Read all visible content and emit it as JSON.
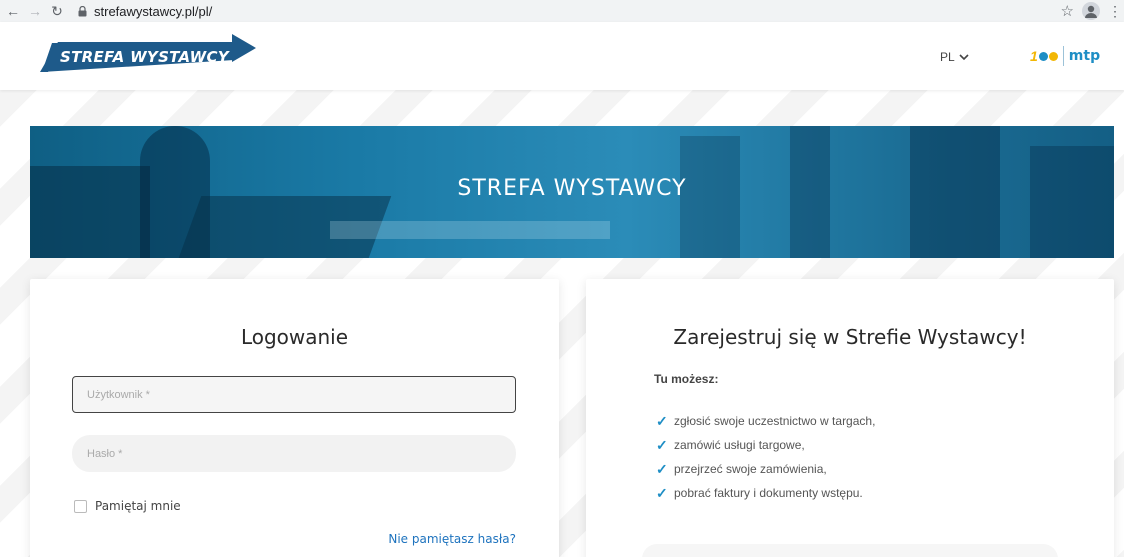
{
  "browser": {
    "url": "strefawystawcy.pl/pl/"
  },
  "header": {
    "logo_text": "STREFA WYSTAWCY",
    "language": "PL",
    "mtp_text": "mtp",
    "mtp_number": "1"
  },
  "banner": {
    "title": "STREFA WYSTAWCY"
  },
  "login": {
    "title": "Logowanie",
    "username_placeholder": "Użytkownik *",
    "password_placeholder": "Hasło *",
    "remember_label": "Pamiętaj mnie",
    "forgot_link": "Nie pamiętasz hasła?"
  },
  "register": {
    "title": "Zarejestruj się w Strefie Wystawcy!",
    "subtitle": "Tu możesz:",
    "benefits": [
      "zgłosić swoje uczestnictwo w targach,",
      "zamówić usługi targowe,",
      "przejrzeć swoje zamówienia,",
      "pobrać faktury i dokumenty wstępu."
    ]
  },
  "colors": {
    "brand_blue": "#1e5a8a",
    "accent_blue": "#1e8ec5",
    "link_blue": "#1e73be",
    "mtp_yellow": "#f2b705"
  }
}
